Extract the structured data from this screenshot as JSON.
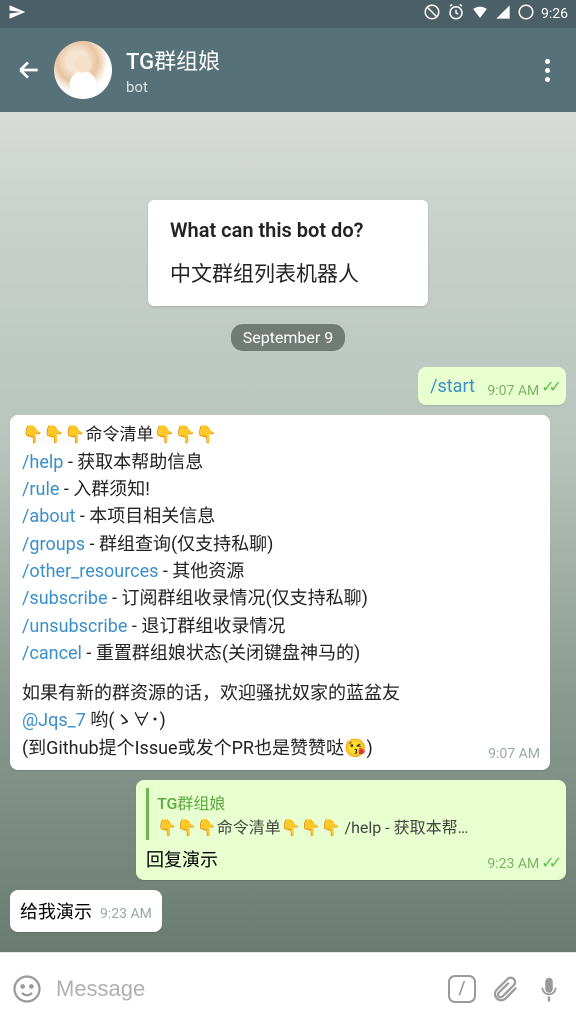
{
  "status": {
    "time": "9:26"
  },
  "header": {
    "title": "TG群组娘",
    "subtitle": "bot"
  },
  "intro": {
    "title": "What can this bot do?",
    "body": "中文群组列表机器人"
  },
  "date_label": "September 9",
  "start_msg": {
    "text": "/start",
    "time": "9:07 AM"
  },
  "help_msg": {
    "header_prefix": "👇👇👇命令清单👇👇👇",
    "lines": [
      {
        "cmd": "/help",
        "desc": " - 获取本帮助信息"
      },
      {
        "cmd": "/rule",
        "desc": " - 入群须知!"
      },
      {
        "cmd": "/about",
        "desc": " - 本项目相关信息"
      },
      {
        "cmd": "/groups",
        "desc": " - 群组查询(仅支持私聊)"
      },
      {
        "cmd": "/other_resources",
        "desc": " - 其他资源"
      },
      {
        "cmd": "/subscribe",
        "desc": " - 订阅群组收录情况(仅支持私聊)"
      },
      {
        "cmd": "/unsubscribe",
        "desc": " - 退订群组收录情况"
      },
      {
        "cmd": "/cancel",
        "desc": " - 重置群组娘状态(关闭键盘神马的)"
      }
    ],
    "footer1": "如果有新的群资源的话，欢迎骚扰奴家的蓝盆友",
    "footer_mention": "@Jqs_7",
    "footer_face": " 哟(ゝ∀･)",
    "footer2_a": "(到Github提个Issue或发个PR也是赞赞哒",
    "footer2_b": ")",
    "time": "9:07 AM"
  },
  "reply_msg": {
    "quote_name": "TG群组娘",
    "quote_text": "👇👇👇命令清单👇👇👇 /help - 获取本帮…",
    "body": "回复演示",
    "time": "9:23 AM"
  },
  "demo_msg": {
    "text": "给我演示",
    "time": "9:23 AM"
  },
  "input": {
    "placeholder": "Message"
  }
}
